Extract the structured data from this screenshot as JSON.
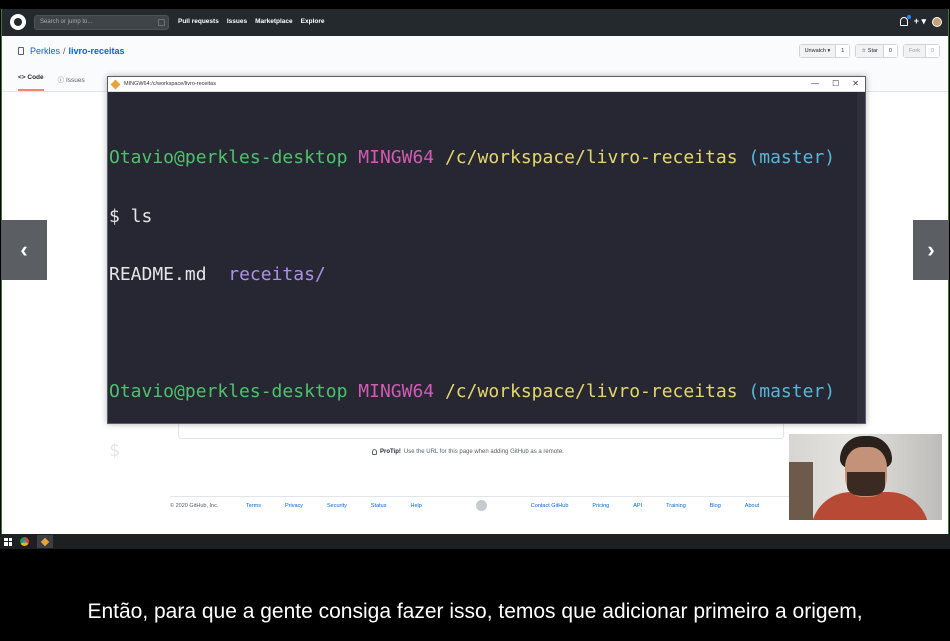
{
  "github": {
    "search_placeholder": "Search or jump to...",
    "nav": [
      "Pull requests",
      "Issues",
      "Marketplace",
      "Explore"
    ],
    "plus_label": "+ ▾",
    "owner": "Perkles",
    "separator": "/",
    "repo": "livro-receitas",
    "unwatch_label": "Unwatch ▾",
    "unwatch_count": "1",
    "star_label": "☆ Star",
    "star_count": "0",
    "fork_label": "Fork",
    "fork_count": "0",
    "tabs": [
      "<> Code",
      "ⓘ Issues"
    ],
    "protip_label": "ProTip!",
    "protip_text": "Use the URL for this page when adding GitHub as a remote.",
    "footer": {
      "copyright": "© 2020 GitHub, Inc.",
      "left_links": [
        "Terms",
        "Privacy",
        "Security",
        "Status",
        "Help"
      ],
      "right_links": [
        "Contact GitHub",
        "Pricing",
        "API",
        "Training",
        "Blog",
        "About"
      ]
    }
  },
  "nav_arrows": {
    "prev": "‹",
    "next": "›"
  },
  "terminal": {
    "title": "MINGW64:/c/workspace/livro-receitas",
    "controls": {
      "minimize": "—",
      "maximize": "☐",
      "close": "✕"
    },
    "prompt_user": "Otavio@perkles-desktop",
    "prompt_env": "MINGW64",
    "prompt_path": "/c/workspace/livro-receitas",
    "prompt_branch": "(master)",
    "command": "$ ls",
    "output_file": "README.md",
    "output_dir": "receitas/",
    "cursor_line": "$"
  },
  "subtitle": "Então, para que a gente consiga fazer isso, temos que adicionar primeiro a origem,"
}
